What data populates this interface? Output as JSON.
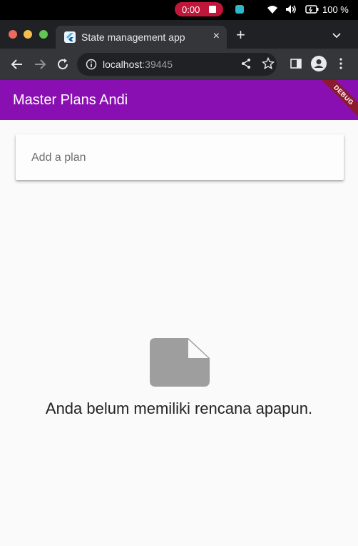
{
  "system": {
    "recording_time": "0:00",
    "battery_label": "100 %"
  },
  "browser": {
    "tab_title": "State management app",
    "tab_close": "×",
    "new_tab": "+",
    "url_host": "localhost",
    "url_port": ":39445"
  },
  "app": {
    "title": "Master Plans Andi",
    "debug_banner": "DEBUG",
    "plan_input": {
      "placeholder": "Add a plan",
      "value": ""
    },
    "empty_message": "Anda belum memiliki rencana apapun."
  },
  "colors": {
    "appbar": "#8a0fb2",
    "recording_pill": "#c0163a",
    "empty_icon": "#9e9e9e"
  },
  "icons": {
    "empty_state": "note-icon"
  }
}
